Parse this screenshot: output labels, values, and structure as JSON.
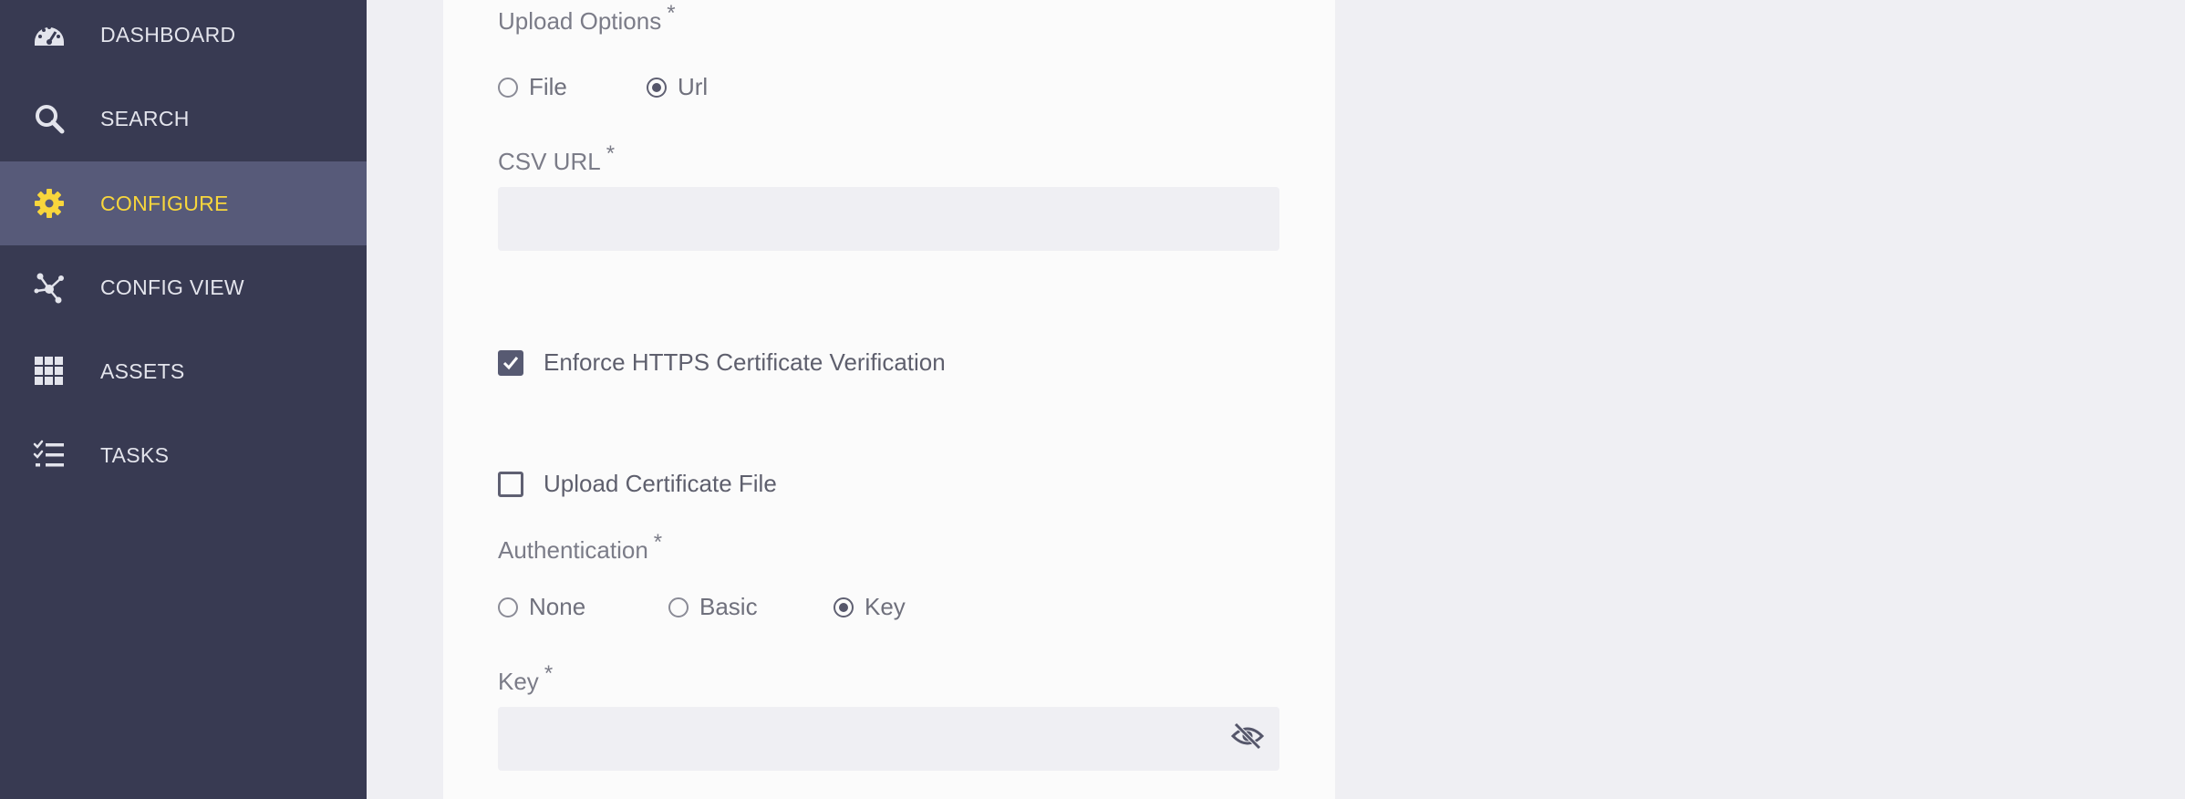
{
  "sidebar": {
    "items": [
      {
        "label": "DASHBOARD",
        "icon": "dashboard-icon",
        "active": false
      },
      {
        "label": "SEARCH",
        "icon": "search-icon",
        "active": false
      },
      {
        "label": "CONFIGURE",
        "icon": "gear-icon",
        "active": true
      },
      {
        "label": "CONFIG VIEW",
        "icon": "graph-icon",
        "active": false
      },
      {
        "label": "ASSETS",
        "icon": "grid-icon",
        "active": false
      },
      {
        "label": "TASKS",
        "icon": "checklist-icon",
        "active": false
      }
    ]
  },
  "form": {
    "upload_options": {
      "label": "Upload Options",
      "required": "*",
      "options": [
        "File",
        "Url"
      ],
      "selected": "Url"
    },
    "csv_url": {
      "label": "CSV URL",
      "required": "*",
      "value": "",
      "placeholder": ""
    },
    "enforce_https": {
      "label": "Enforce HTTPS Certificate Verification",
      "checked": true
    },
    "upload_certificate": {
      "label": "Upload Certificate File",
      "checked": false
    },
    "authentication": {
      "label": "Authentication",
      "required": "*",
      "options": [
        "None",
        "Basic",
        "Key"
      ],
      "selected": "Key"
    },
    "key": {
      "label": "Key",
      "required": "*",
      "value": "",
      "placeholder": "",
      "toggle_icon": "eye-off-icon"
    }
  },
  "colors": {
    "sidebar_bg": "#383a52",
    "sidebar_active_bg": "#575a79",
    "active_text": "#f8d63c",
    "page_bg": "#efeff3",
    "panel_bg": "#fbfbfb"
  }
}
